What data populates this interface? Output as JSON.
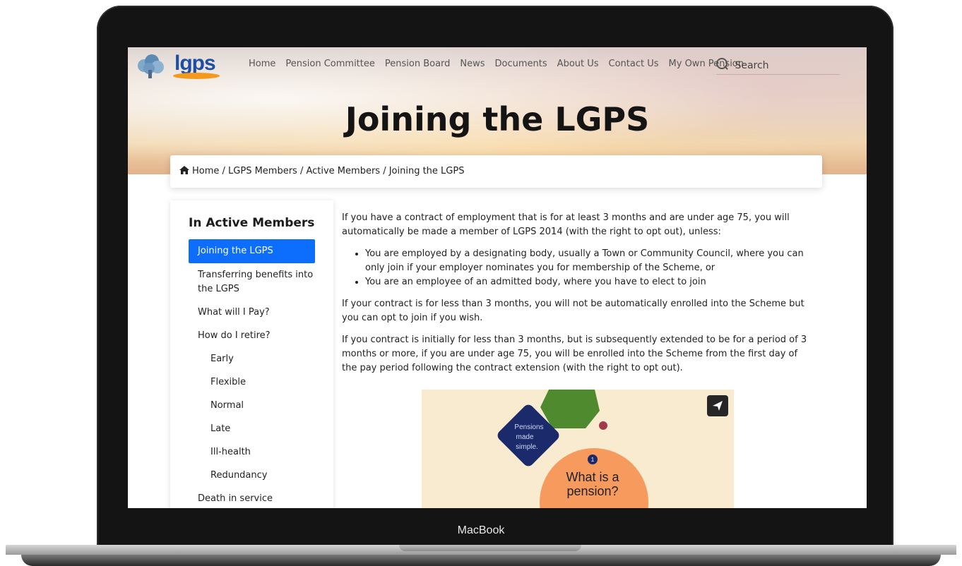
{
  "device_label": "MacBook",
  "brand": {
    "logo_text": "lgps"
  },
  "nav": {
    "items": [
      {
        "label": "Home"
      },
      {
        "label": "Pension Committee"
      },
      {
        "label": "Pension Board"
      },
      {
        "label": "News"
      },
      {
        "label": "Documents"
      },
      {
        "label": "About Us"
      },
      {
        "label": "Contact Us"
      },
      {
        "label": "My Own Pension"
      }
    ],
    "search_label": "Search"
  },
  "page_title": "Joining the LGPS",
  "breadcrumb": "Home / LGPS Members / Active Members / Joining the LGPS",
  "sidebar": {
    "title": "In Active Members",
    "items": [
      {
        "label": "Joining the LGPS"
      },
      {
        "label": "Transferring benefits into the LGPS"
      },
      {
        "label": "What will I Pay?"
      },
      {
        "label": "How do I retire?"
      },
      {
        "label": "Early"
      },
      {
        "label": "Flexible"
      },
      {
        "label": "Normal"
      },
      {
        "label": "Late"
      },
      {
        "label": "Ill-health"
      },
      {
        "label": "Redundancy"
      },
      {
        "label": "Death in service"
      }
    ]
  },
  "content": {
    "intro": "If you have a contract of employment that is for at least 3 months and are under age 75, you will automatically be made a member of LGPS 2014 (with the right to opt out), unless:",
    "bullets": [
      "You are employed by a designating body, usually a Town or Community Council, where you can only join if your employer nominates you for membership of the Scheme, or",
      "You are an employee of an admitted body, where you have to elect to join"
    ],
    "para2": "If your contract is for less than 3 months, you will not be automatically enrolled into the Scheme but you can opt to join if you wish.",
    "para3": "If you contract is initially for less than 3 months, but is subsequently extended to be for a period of 3 months or more, if you are under age 75, you will be enrolled into the Scheme from the first day of the pay period following the contract extension (with the right to opt out)."
  },
  "video": {
    "badge_line1": "Pensions",
    "badge_line2": "made",
    "badge_line3": "simple.",
    "step_number": "1",
    "headline_line1": "What is a",
    "headline_line2": "pension?"
  },
  "colors": {
    "accent": "#0d6efd",
    "video_bg": "#f8ebd0",
    "orange_circle": "#f79a5e",
    "navy_diamond": "#1b2a6b",
    "green_shape": "#4f8a2e"
  }
}
